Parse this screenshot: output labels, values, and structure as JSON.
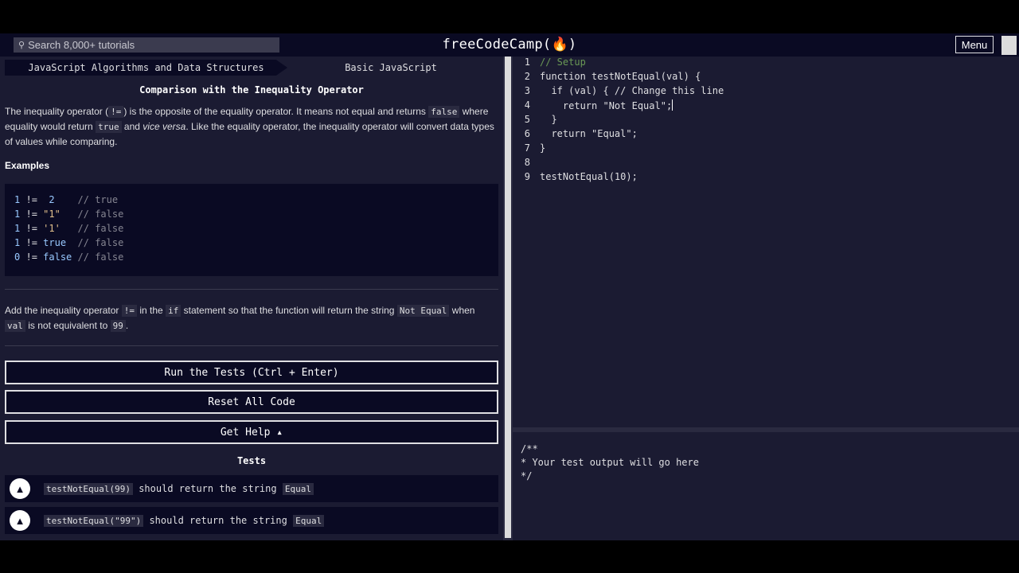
{
  "nav": {
    "search_placeholder": "Search 8,000+ tutorials",
    "brand": "freeCodeCamp(🔥)",
    "menu_label": "Menu"
  },
  "breadcrumbs": [
    "JavaScript Algorithms and Data Structures",
    "Basic JavaScript"
  ],
  "challenge": {
    "title": "Comparison with the Inequality Operator",
    "p1": {
      "a": "The inequality operator (",
      "code1": "!=",
      "b": ") is the opposite of the equality operator. It means not equal and returns",
      "code2": "false",
      "c": "where equality would return",
      "code3": "true",
      "d": "and",
      "em": "vice versa",
      "e": ". Like the equality operator, the inequality operator will convert data types of values while comparing."
    },
    "examples_heading": "Examples",
    "examples": [
      {
        "lhs": "1",
        "op": "!=",
        "rhs": "2",
        "comment": "// true"
      },
      {
        "lhs": "1",
        "op": "!=",
        "rhs": "\"1\"",
        "comment": "// false"
      },
      {
        "lhs": "1",
        "op": "!=",
        "rhs": "'1'",
        "comment": "// false"
      },
      {
        "lhs": "1",
        "op": "!=",
        "rhs": "true",
        "comment": "// false"
      },
      {
        "lhs": "0",
        "op": "!=",
        "rhs": "false",
        "comment": "// false"
      }
    ],
    "p2": {
      "a": "Add the inequality operator",
      "code1": "!=",
      "b": "in the",
      "code2": "if",
      "c": "statement so that the function will return the string",
      "code3": "Not Equal",
      "d": "when",
      "code4": "val",
      "e": "is not equivalent to",
      "code5": "99",
      "f": "."
    }
  },
  "buttons": {
    "run": "Run the Tests (Ctrl + Enter)",
    "reset": "Reset All Code",
    "help": "Get Help ▴"
  },
  "tests": {
    "heading": "Tests",
    "items": [
      {
        "code": "testNotEqual(99)",
        "text": "should return the string",
        "value": "Equal"
      },
      {
        "code": "testNotEqual(\"99\")",
        "text": "should return the string",
        "value": "Equal"
      }
    ]
  },
  "editor": {
    "line_numbers": [
      "1",
      "2",
      "3",
      "4",
      "5",
      "6",
      "7",
      "8",
      "9"
    ],
    "lines": [
      "// Setup",
      "function testNotEqual(val) {",
      "  if (val) { // Change this line",
      "    return \"Not Equal\";",
      "  }",
      "  return \"Equal\";",
      "}",
      "",
      "testNotEqual(10);"
    ]
  },
  "output": {
    "lines": [
      "/**",
      "* Your test output will go here",
      "*/"
    ]
  }
}
